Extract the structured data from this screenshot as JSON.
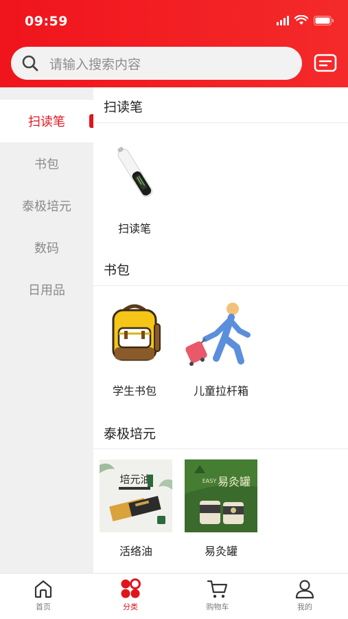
{
  "status_bar": {
    "time": "09:59"
  },
  "search": {
    "placeholder": "请输入搜索内容"
  },
  "sidebar": {
    "items": [
      {
        "label": "扫读笔",
        "active": true
      },
      {
        "label": "书包",
        "active": false
      },
      {
        "label": "泰极培元",
        "active": false
      },
      {
        "label": "数码",
        "active": false
      },
      {
        "label": "日用品",
        "active": false
      }
    ]
  },
  "sections": [
    {
      "title": "扫读笔",
      "products": [
        {
          "name": "扫读笔",
          "icon": "scan-pen-image"
        }
      ]
    },
    {
      "title": "书包",
      "products": [
        {
          "name": "学生书包",
          "icon": "backpack-image"
        },
        {
          "name": "儿童拉杆箱",
          "icon": "trolley-case-image"
        }
      ]
    },
    {
      "title": "泰极培元",
      "products": [
        {
          "name": "活络油",
          "icon": "oil-product-image",
          "image_text": "培元油"
        },
        {
          "name": "易灸罐",
          "icon": "moxibustion-jar-image",
          "image_text": "易灸罐",
          "image_subtext": "EASY"
        }
      ]
    }
  ],
  "tabbar": {
    "tabs": [
      {
        "label": "首页",
        "icon": "home-icon",
        "active": false
      },
      {
        "label": "分类",
        "icon": "category-icon",
        "active": true
      },
      {
        "label": "购物车",
        "icon": "cart-icon",
        "active": false
      },
      {
        "label": "我的",
        "icon": "profile-icon",
        "active": false
      }
    ]
  },
  "colors": {
    "brand": "#e0141c",
    "sidebar_bg": "#f0f0f0",
    "muted_text": "#8a8a8a"
  }
}
